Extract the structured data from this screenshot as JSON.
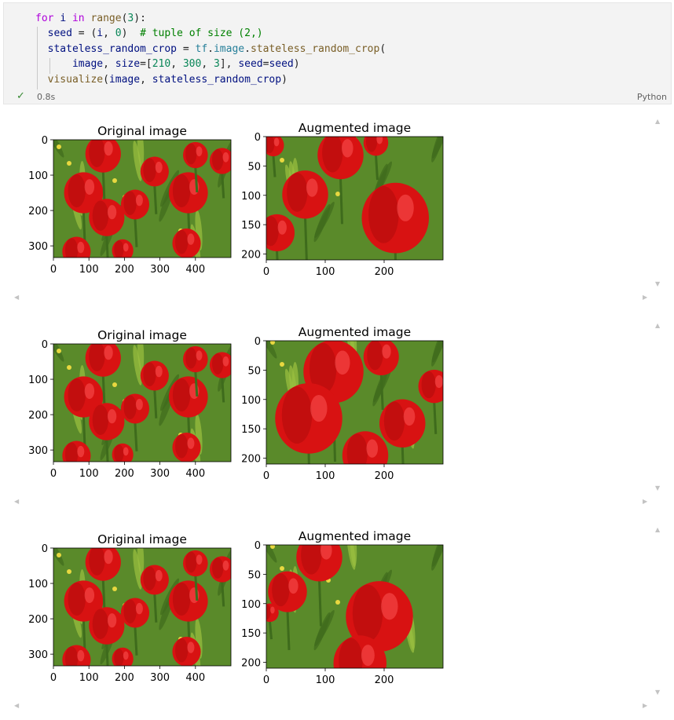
{
  "code_cell": {
    "lines": [
      [
        {
          "t": "for ",
          "c": "k"
        },
        {
          "t": "i ",
          "c": "v"
        },
        {
          "t": "in ",
          "c": "k"
        },
        {
          "t": "range",
          "c": "f"
        },
        {
          "t": "(",
          "c": ""
        },
        {
          "t": "3",
          "c": "n"
        },
        {
          "t": "):",
          "c": ""
        }
      ],
      [
        {
          "t": "  seed",
          "c": "v"
        },
        {
          "t": " = (",
          "c": ""
        },
        {
          "t": "i",
          "c": "v"
        },
        {
          "t": ", ",
          "c": ""
        },
        {
          "t": "0",
          "c": "n"
        },
        {
          "t": ")  ",
          "c": ""
        },
        {
          "t": "# tuple of size (2,)",
          "c": "c"
        }
      ],
      [
        {
          "t": "  stateless_random_crop",
          "c": "v"
        },
        {
          "t": " = ",
          "c": ""
        },
        {
          "t": "tf",
          "c": "m"
        },
        {
          "t": ".",
          "c": ""
        },
        {
          "t": "image",
          "c": "m"
        },
        {
          "t": ".",
          "c": ""
        },
        {
          "t": "stateless_random_crop",
          "c": "f"
        },
        {
          "t": "(",
          "c": ""
        }
      ],
      [
        {
          "t": "      image",
          "c": "v"
        },
        {
          "t": ", ",
          "c": ""
        },
        {
          "t": "size",
          "c": "v"
        },
        {
          "t": "=[",
          "c": ""
        },
        {
          "t": "210",
          "c": "n"
        },
        {
          "t": ", ",
          "c": ""
        },
        {
          "t": "300",
          "c": "n"
        },
        {
          "t": ", ",
          "c": ""
        },
        {
          "t": "3",
          "c": "n"
        },
        {
          "t": "], ",
          "c": ""
        },
        {
          "t": "seed",
          "c": "v"
        },
        {
          "t": "=",
          "c": ""
        },
        {
          "t": "seed",
          "c": "v"
        },
        {
          "t": ")",
          "c": ""
        }
      ],
      [
        {
          "t": "  visualize",
          "c": "f"
        },
        {
          "t": "(",
          "c": ""
        },
        {
          "t": "image",
          "c": "v"
        },
        {
          "t": ", ",
          "c": ""
        },
        {
          "t": "stateless_random_crop",
          "c": "v"
        },
        {
          "t": ")",
          "c": ""
        }
      ]
    ],
    "status_icon": "check-icon",
    "exec_time": "0.8s",
    "language": "Python"
  },
  "outputs": [
    {
      "original": {
        "title": "Original image",
        "xticks": [
          "0",
          "100",
          "200",
          "300",
          "400"
        ],
        "yticks": [
          "0",
          "100",
          "200",
          "300"
        ]
      },
      "augmented": {
        "title": "Augmented image",
        "xticks": [
          "0",
          "100",
          "200"
        ],
        "yticks": [
          "0",
          "50",
          "100",
          "150",
          "200"
        ]
      }
    },
    {
      "original": {
        "title": "Original image",
        "xticks": [
          "0",
          "100",
          "200",
          "300",
          "400"
        ],
        "yticks": [
          "0",
          "100",
          "200",
          "300"
        ]
      },
      "augmented": {
        "title": "Augmented image",
        "xticks": [
          "0",
          "100",
          "200"
        ],
        "yticks": [
          "0",
          "50",
          "100",
          "150",
          "200"
        ]
      }
    },
    {
      "original": {
        "title": "Original image",
        "xticks": [
          "0",
          "100",
          "200",
          "300",
          "400"
        ],
        "yticks": [
          "0",
          "100",
          "200",
          "300"
        ]
      },
      "augmented": {
        "title": "Augmented image",
        "xticks": [
          "0",
          "100",
          "200"
        ],
        "yticks": [
          "0",
          "50",
          "100",
          "150",
          "200"
        ]
      }
    }
  ],
  "colors": {
    "tulip_red": "#d81212",
    "tulip_dark": "#9c0a0a",
    "foliage": "#5a8a2a",
    "foliage_light": "#9bc040",
    "flower_yellow": "#e8d840"
  }
}
